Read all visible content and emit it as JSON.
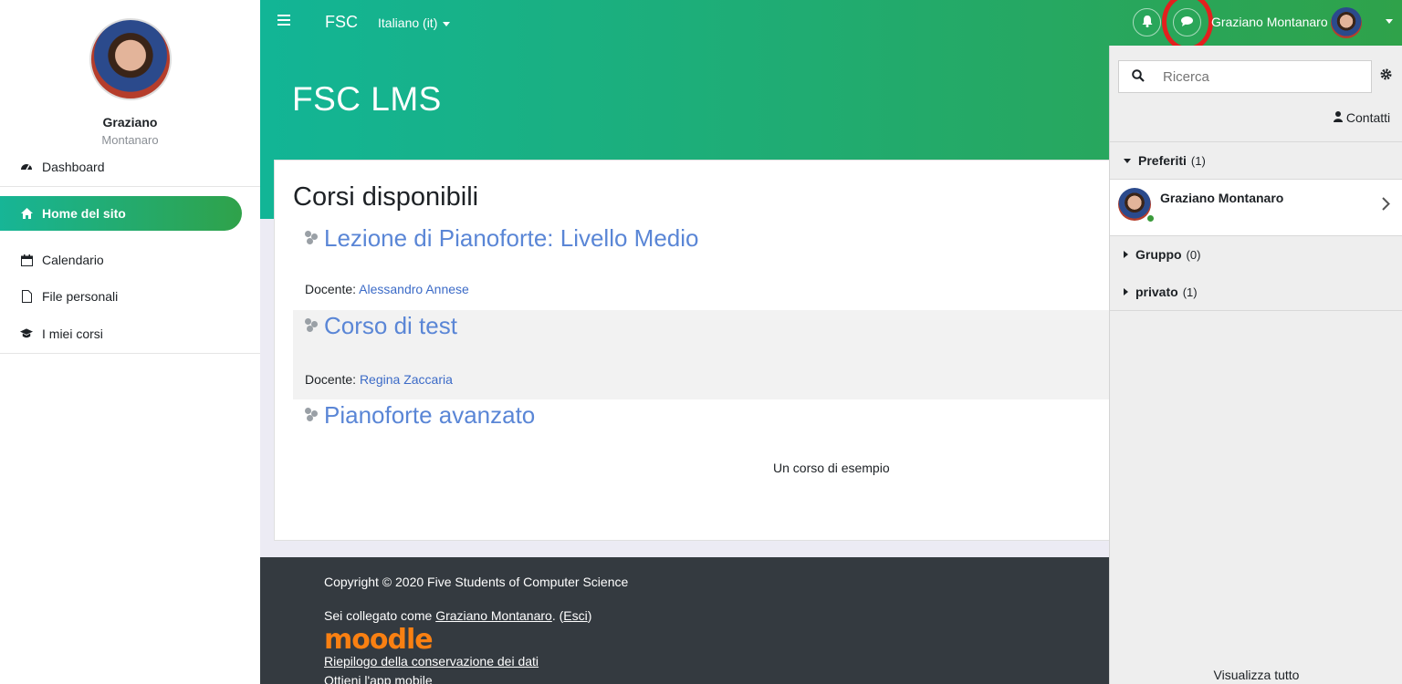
{
  "sidebar": {
    "user_first": "Graziano",
    "user_last": "Montanaro",
    "items": [
      {
        "label": "Dashboard",
        "icon": "dashboard-icon"
      },
      {
        "label": "Home del sito",
        "icon": "home-icon",
        "active": true
      },
      {
        "label": "Calendario",
        "icon": "calendar-icon"
      },
      {
        "label": "File personali",
        "icon": "file-icon"
      },
      {
        "label": "I miei corsi",
        "icon": "graduation-cap-icon"
      }
    ]
  },
  "topbar": {
    "brand": "FSC",
    "language": "Italiano (it)",
    "user_name": "Graziano Montanaro"
  },
  "header": {
    "site_title": "FSC LMS"
  },
  "main": {
    "section_title": "Corsi disponibili",
    "courses": [
      {
        "name": "Lezione di Pianoforte: Livello Medio",
        "teacher_label": "Docente: ",
        "teacher": "Alessandro Annese"
      },
      {
        "name": "Corso di test",
        "teacher_label": "Docente: ",
        "teacher": "Regina Zaccaria"
      },
      {
        "name": "Pianoforte avanzato",
        "summary": "Un corso di esempio"
      }
    ]
  },
  "footer": {
    "copyright": "Copyright © 2020 Five Students of Computer Science",
    "logged_prefix": "Sei collegato come ",
    "logged_user": "Graziano Montanaro",
    "logged_mid": ". (",
    "logout": "Esci",
    "logged_suffix": ")",
    "logo_text": "moodle",
    "data_retention": "Riepilogo della conservazione dei dati",
    "mobile_app": "Ottieni l'app mobile"
  },
  "drawer": {
    "search_placeholder": "Ricerca",
    "contacts": "Contatti",
    "groups": [
      {
        "label": "Preferiti",
        "count": "(1)",
        "expanded": true
      },
      {
        "label": "Gruppo",
        "count": "(0)",
        "expanded": false
      },
      {
        "label": "privato",
        "count": "(1)",
        "expanded": false
      }
    ],
    "favorite_contact": "Graziano Montanaro",
    "view_all": "Visualizza tutto"
  },
  "colors": {
    "header_gradient_start": "#12b596",
    "header_gradient_end": "#2fa24a",
    "link": "#3c6bc7",
    "highlight_ring": "#e3201e",
    "footer_bg": "#343a40"
  }
}
